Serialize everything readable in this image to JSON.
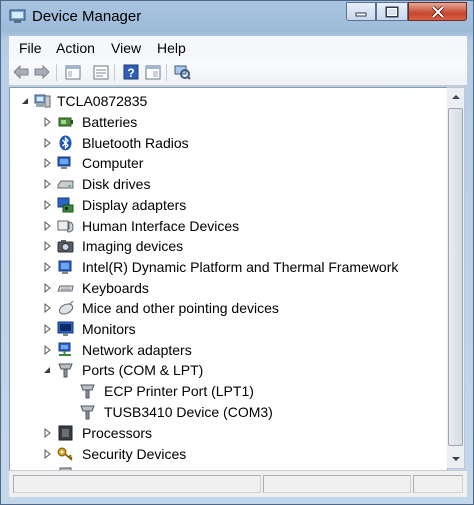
{
  "window": {
    "title": "Device Manager",
    "buttons": {
      "minimize": "minimize",
      "maximize": "maximize",
      "close": "close"
    }
  },
  "menu": [
    "File",
    "Action",
    "View",
    "Help"
  ],
  "toolbar": {
    "buttons": [
      "back-icon",
      "forward-icon",
      "show-hide-console-tree-icon",
      "properties-icon",
      "help-icon",
      "properties-sheet-icon",
      "scan-hardware-icon"
    ]
  },
  "tree": {
    "root": "TCLA0872835",
    "items": [
      {
        "label": "Batteries",
        "icon": "battery-icon",
        "expanded": false
      },
      {
        "label": "Bluetooth Radios",
        "icon": "bluetooth-icon",
        "expanded": false
      },
      {
        "label": "Computer",
        "icon": "computer-icon",
        "expanded": false
      },
      {
        "label": "Disk drives",
        "icon": "disk-drive-icon",
        "expanded": false
      },
      {
        "label": "Display adapters",
        "icon": "display-adapter-icon",
        "expanded": false
      },
      {
        "label": "Human Interface Devices",
        "icon": "hid-icon",
        "expanded": false
      },
      {
        "label": "Imaging devices",
        "icon": "camera-icon",
        "expanded": false
      },
      {
        "label": "Intel(R) Dynamic Platform and Thermal Framework",
        "icon": "chip-icon",
        "expanded": false
      },
      {
        "label": "Keyboards",
        "icon": "keyboard-icon",
        "expanded": false
      },
      {
        "label": "Mice and other pointing devices",
        "icon": "mouse-icon",
        "expanded": false
      },
      {
        "label": "Monitors",
        "icon": "monitor-icon",
        "expanded": false
      },
      {
        "label": "Network adapters",
        "icon": "network-icon",
        "expanded": false
      },
      {
        "label": "Ports (COM & LPT)",
        "icon": "port-icon",
        "expanded": true,
        "children": [
          {
            "label": "ECP Printer Port (LPT1)",
            "icon": "port-icon"
          },
          {
            "label": "TUSB3410 Device (COM3)",
            "icon": "port-icon"
          }
        ]
      },
      {
        "label": "Processors",
        "icon": "processor-icon",
        "expanded": false
      },
      {
        "label": "Security Devices",
        "icon": "security-key-icon",
        "expanded": false
      }
    ]
  },
  "colors": {
    "window_frame": "#9dbbd9",
    "close_button": "#c7472f",
    "selection": "#3399ff"
  }
}
